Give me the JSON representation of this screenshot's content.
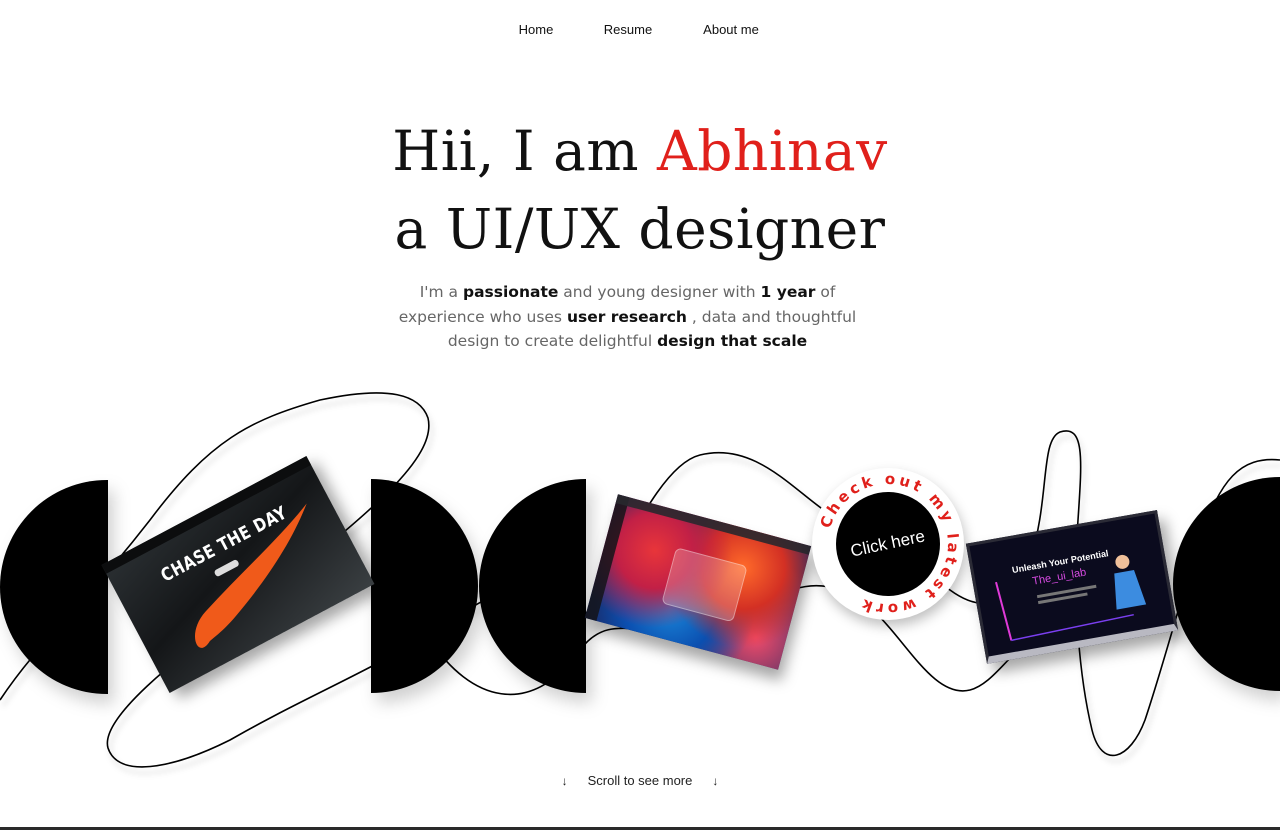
{
  "nav": {
    "items": [
      {
        "label": "Home"
      },
      {
        "label": "Resume"
      },
      {
        "label": "About me"
      }
    ]
  },
  "hero": {
    "line1_prefix": "Hii, I am ",
    "name": "Abhinav",
    "line2": "a UI/UX designer",
    "accent_color": "#e0201b"
  },
  "intro": {
    "t1": "I'm a ",
    "b1": "passionate",
    "t2": " and young designer with ",
    "b2": "1 year",
    "t3": " of experience who uses ",
    "b3": "user research",
    "t4": " , data and thoughtful design to create delightful ",
    "b4": "design that scale"
  },
  "gallery": {
    "nike": {
      "headline": "CHASE THE DAY"
    },
    "lab": {
      "headline": "Unleash Your Potential",
      "brand": "The_ui_lab"
    }
  },
  "cta": {
    "ring_text": "Check out my latest work",
    "button": "Click here"
  },
  "footer": {
    "scroll_label": "Scroll to see more",
    "arrow_icon": "↓"
  }
}
